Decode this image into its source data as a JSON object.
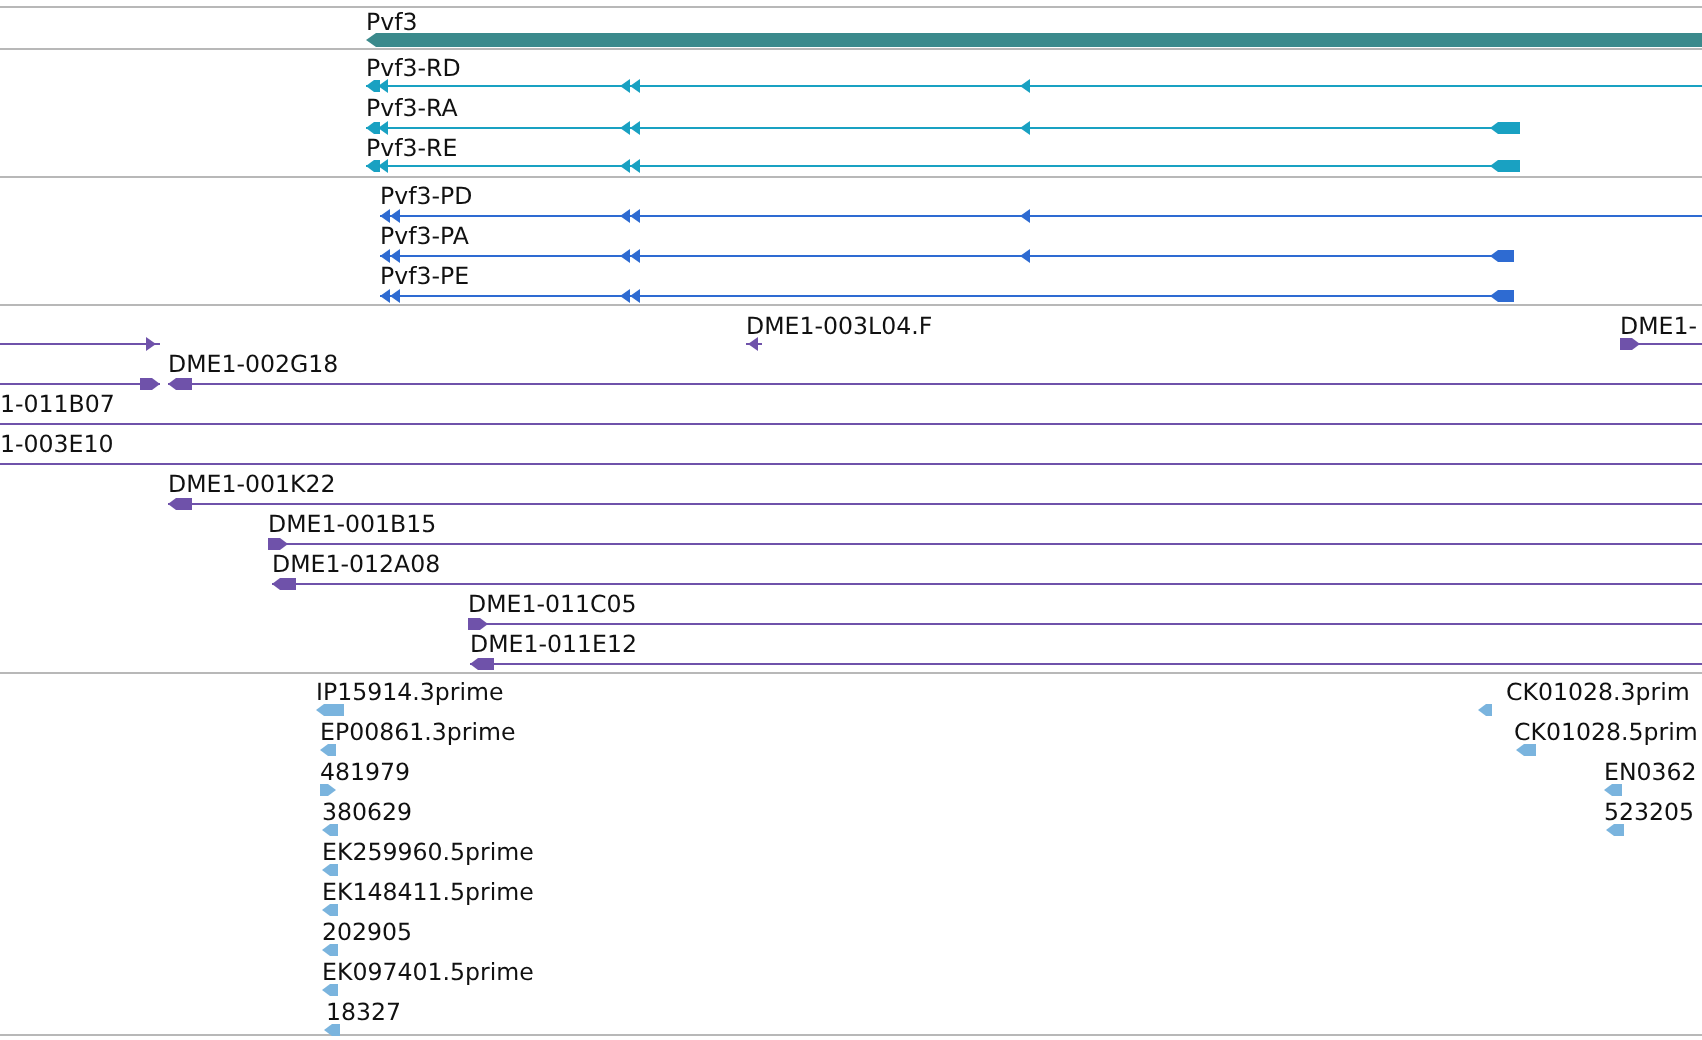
{
  "tracks": [
    {
      "kind": "gene",
      "color": "#3b8a8c",
      "features": [
        {
          "label": "Pvf3"
        }
      ]
    },
    {
      "kind": "transcript",
      "color": "#19a1c2",
      "features": [
        {
          "label": "Pvf3-RD"
        },
        {
          "label": "Pvf3-RA"
        },
        {
          "label": "Pvf3-RE"
        }
      ]
    },
    {
      "kind": "protein",
      "color": "#2e6bd2",
      "features": [
        {
          "label": "Pvf3-PD"
        },
        {
          "label": "Pvf3-PA"
        },
        {
          "label": "Pvf3-PE"
        }
      ]
    },
    {
      "kind": "clone",
      "color": "#6f52aa",
      "features": [
        {
          "label": "DME1-003L04.F"
        },
        {
          "label": "DME1-"
        },
        {
          "label": "DME1-002G18"
        },
        {
          "label": "1-011B07"
        },
        {
          "label": "1-003E10"
        },
        {
          "label": "DME1-001K22"
        },
        {
          "label": "DME1-001B15"
        },
        {
          "label": "DME1-012A08"
        },
        {
          "label": "DME1-011C05"
        },
        {
          "label": "DME1-011E12"
        }
      ]
    },
    {
      "kind": "est",
      "color": "#7ab4de",
      "features": [
        {
          "label": "IP15914.3prime"
        },
        {
          "label": "EP00861.3prime"
        },
        {
          "label": "481979"
        },
        {
          "label": "380629"
        },
        {
          "label": "EK259960.5prime"
        },
        {
          "label": "EK148411.5prime"
        },
        {
          "label": "202905"
        },
        {
          "label": "EK097401.5prime"
        },
        {
          "label": "18327"
        },
        {
          "label": "CK01028.3prim"
        },
        {
          "label": "CK01028.5prim"
        },
        {
          "label": "EN0362"
        },
        {
          "label": "523205"
        }
      ]
    }
  ]
}
